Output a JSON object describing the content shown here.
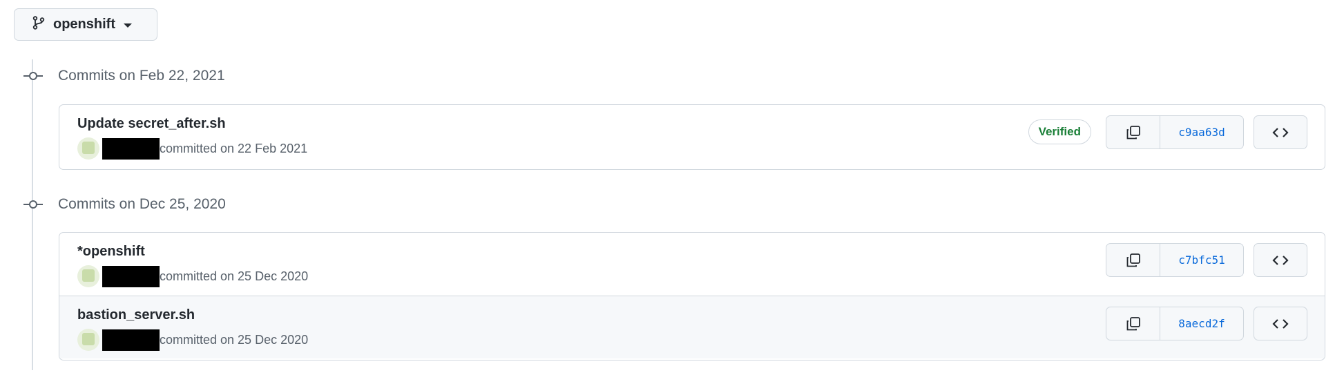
{
  "branch": {
    "name": "openshift",
    "icon": "git-branch-icon"
  },
  "groups": [
    {
      "label": "Commits on Feb 22, 2021",
      "commits": [
        {
          "title": "Update secret_after.sh",
          "meta": "committed on 22 Feb 2021",
          "verified": "Verified",
          "sha": "c9aa63d"
        }
      ]
    },
    {
      "label": "Commits on Dec 25, 2020",
      "commits": [
        {
          "title": "*openshift",
          "meta": "committed on 25 Dec 2020",
          "sha": "c7bfc51"
        },
        {
          "title": "bastion_server.sh",
          "meta": "committed on 25 Dec 2020",
          "sha": "8aecd2f"
        }
      ]
    }
  ],
  "colors": {
    "verified": "#1a7f37",
    "sha": "#0969da",
    "border": "#d0d7de",
    "muted": "#57606a"
  }
}
